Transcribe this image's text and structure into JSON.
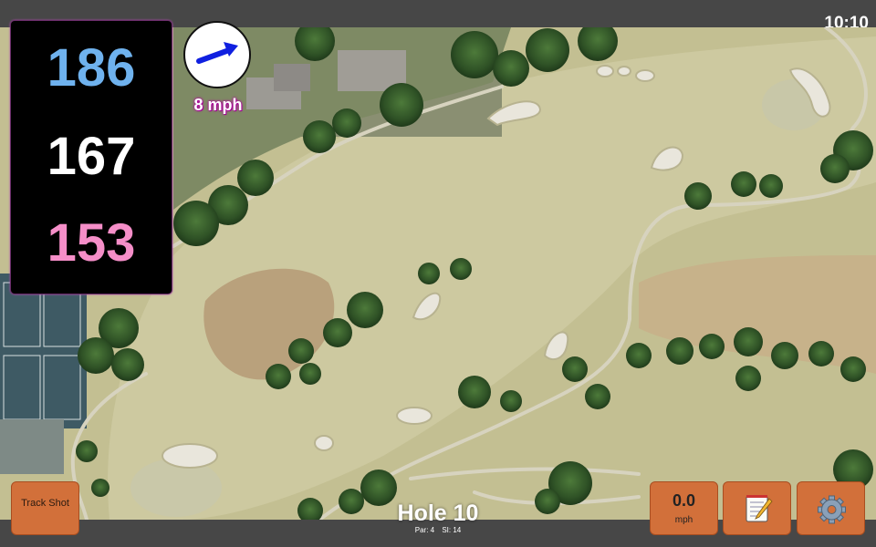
{
  "status": {
    "clock": "10:10"
  },
  "distances": {
    "back": "186",
    "center": "167",
    "front": "153"
  },
  "wind": {
    "speed": "8 mph",
    "icon": "wind-arrow-icon"
  },
  "hole": {
    "title": "Hole 10",
    "par": "Par: 4",
    "stroke_index": "SI: 14"
  },
  "buttons": {
    "track_shot": "Track Shot",
    "speed_value": "0.0",
    "speed_unit": "mph",
    "notes_icon": "notepad-icon",
    "settings_icon": "gear-icon"
  },
  "colors": {
    "back_distance": "#6fb2ee",
    "center_distance": "#ffffff",
    "front_distance": "#f58ec8",
    "button_bg": "#d2703a",
    "wind_arrow": "#1020e0",
    "wind_text_glow": "#b400a0"
  }
}
